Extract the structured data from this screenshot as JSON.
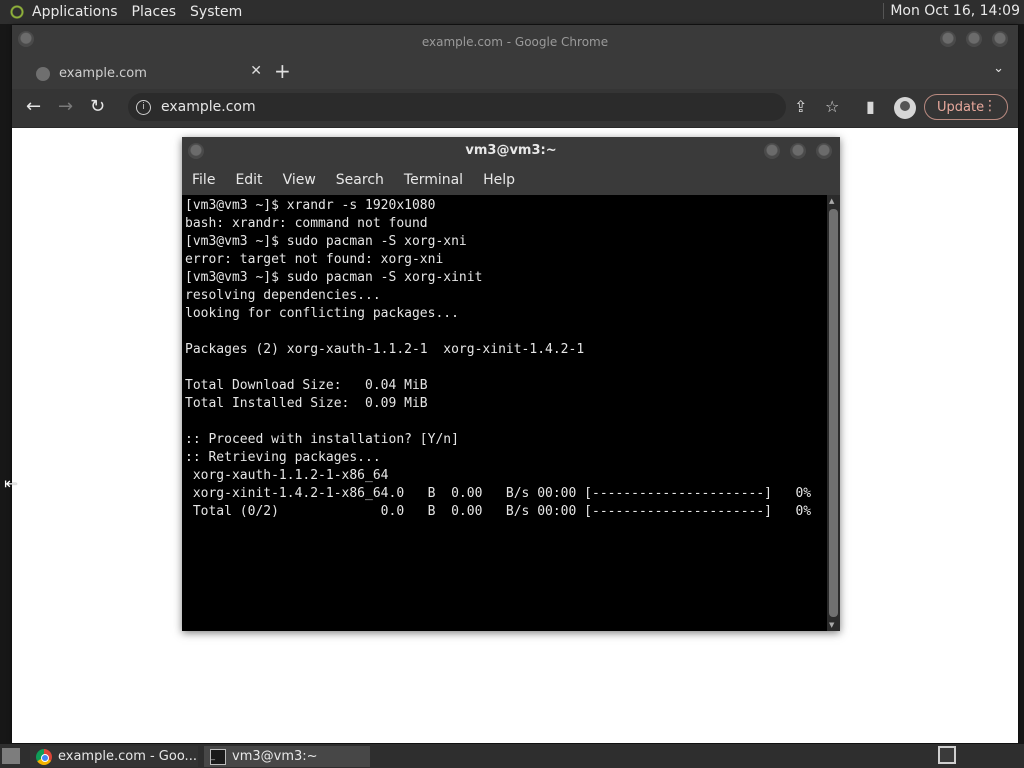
{
  "top_panel": {
    "menus": [
      "Applications",
      "Places",
      "System"
    ],
    "clock": "Mon Oct 16, 14:09"
  },
  "chrome": {
    "window_title": "example.com - Google Chrome",
    "tab_title": "example.com",
    "tab_close": "✕",
    "new_tab": "+",
    "tab_list": "⌄",
    "back": "←",
    "forward": "→",
    "reload": "↻",
    "url": "example.com",
    "update_label": "Update",
    "kebab": "⋮",
    "share": "⇪",
    "bookmark": "☆",
    "sidepanel": "▮"
  },
  "terminal": {
    "title": "vm3@vm3:~",
    "menu": [
      "File",
      "Edit",
      "View",
      "Search",
      "Terminal",
      "Help"
    ],
    "lines": [
      "[vm3@vm3 ~]$ xrandr -s 1920x1080",
      "bash: xrandr: command not found",
      "[vm3@vm3 ~]$ sudo pacman -S xorg-xni",
      "error: target not found: xorg-xni",
      "[vm3@vm3 ~]$ sudo pacman -S xorg-xinit",
      "resolving dependencies...",
      "looking for conflicting packages...",
      "",
      "Packages (2) xorg-xauth-1.1.2-1  xorg-xinit-1.4.2-1",
      "",
      "Total Download Size:   0.04 MiB",
      "Total Installed Size:  0.09 MiB",
      "",
      ":: Proceed with installation? [Y/n]",
      ":: Retrieving packages...",
      " xorg-xauth-1.1.2-1-x86_64",
      " xorg-xinit-1.4.2-1-x86_64.0   B  0.00   B/s 00:00 [----------------------]   0%",
      " Total (0/2)             0.0   B  0.00   B/s 00:00 [----------------------]   0%"
    ]
  },
  "taskbar": {
    "items": [
      {
        "label": "example.com - Goo..."
      },
      {
        "label": "vm3@vm3:~"
      }
    ]
  }
}
